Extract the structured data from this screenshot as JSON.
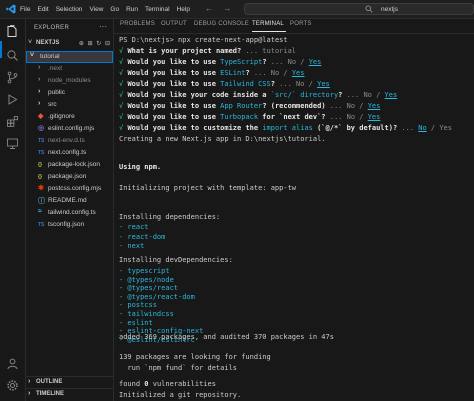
{
  "titlebar": {
    "menu": [
      "File",
      "Edit",
      "Selection",
      "View",
      "Go",
      "Run",
      "Terminal",
      "Help"
    ],
    "nav_arrows": "← →",
    "command_center": "nextjs"
  },
  "sidebar": {
    "title": "EXPLORER",
    "dots": "···",
    "project": "NEXTJS",
    "folder_chevron": "˅",
    "tools": "⊕ ⊞ ↻ ⊟",
    "tree": [
      {
        "label": "tutorial",
        "icon": "˅",
        "color": "#cccccc",
        "icon_color": "#cccccc"
      },
      {
        "label": ".next",
        "icon": "›",
        "color": "#8c8c8c",
        "icon_color": "#8c8c8c"
      },
      {
        "label": "node_modules",
        "icon": "›",
        "color": "#8c8c8c",
        "icon_color": "#8c8c8c"
      },
      {
        "label": "public",
        "icon": "›",
        "color": "#cccccc",
        "icon_color": "#cccccc"
      },
      {
        "label": "src",
        "icon": "›",
        "color": "#cccccc",
        "icon_color": "#cccccc"
      },
      {
        "label": ".gitignore",
        "icon": "◆",
        "color": "#cccccc",
        "icon_color": "#e35a3a"
      },
      {
        "label": "eslint.config.mjs",
        "icon": "◎",
        "color": "#cccccc",
        "icon_color": "#7b6fd8"
      },
      {
        "label": "next-env.d.ts",
        "icon": "TS",
        "color": "#8c8c8c",
        "icon_color": "#3178c6"
      },
      {
        "label": "next.config.ts",
        "icon": "TS",
        "color": "#cccccc",
        "icon_color": "#3178c6"
      },
      {
        "label": "package-lock.json",
        "icon": "{}",
        "color": "#cccccc",
        "icon_color": "#cbcb41"
      },
      {
        "label": "package.json",
        "icon": "{}",
        "color": "#cccccc",
        "icon_color": "#cbcb41"
      },
      {
        "label": "postcss.config.mjs",
        "icon": "✱",
        "color": "#cccccc",
        "icon_color": "#dd3a0a"
      },
      {
        "label": "README.md",
        "icon": "ⓘ",
        "color": "#cccccc",
        "icon_color": "#519aba"
      },
      {
        "label": "tailwind.config.ts",
        "icon": "≈",
        "color": "#cccccc",
        "icon_color": "#38bdf8"
      },
      {
        "label": "tsconfig.json",
        "icon": "TS",
        "color": "#cccccc",
        "icon_color": "#3178c6"
      }
    ],
    "outline": "OUTLINE",
    "timeline": "TIMELINE",
    "collapsed_chevron": "›"
  },
  "panel": {
    "tabs": [
      "PROBLEMS",
      "OUTPUT",
      "DEBUG CONSOLE",
      "TERMINAL",
      "PORTS"
    ],
    "active_tab": "TERMINAL"
  },
  "terminal": {
    "prompt": "PS D:\\nextjs> ",
    "command": "npx create-next-app@latest",
    "questions": [
      {
        "check": "√",
        "q": "What is your project named?",
        "a": " ... tutorial"
      },
      {
        "check": "√",
        "q": "Would you like to use ",
        "hl": "TypeScript",
        "q2": "?",
        "a": " ... No / ",
        "yes": "Yes"
      },
      {
        "check": "√",
        "q": "Would you like to use ",
        "hl": "ESLint",
        "q2": "?",
        "a": " ... No / ",
        "yes": "Yes"
      },
      {
        "check": "√",
        "q": "Would you like to use ",
        "hl": "Tailwind CSS",
        "q2": "?",
        "a": " ... No / ",
        "yes": "Yes"
      },
      {
        "check": "√",
        "q": "Would you like your code inside a ",
        "hl": "`src/` directory",
        "q2": "?",
        "a": " ... No / ",
        "yes": "Yes"
      },
      {
        "check": "√",
        "q": "Would you like to use ",
        "hl": "App Router",
        "q2": "? (recommended)",
        "a": " ... No / ",
        "yes": "Yes"
      },
      {
        "check": "√",
        "q": "Would you like to use ",
        "hl": "Turbopack",
        "q2": " for `next dev`?",
        "a": " ... No / ",
        "yes": "Yes"
      },
      {
        "check": "√",
        "q": "Would you like to customize the ",
        "hl": "import alias",
        "q2": " (`@/*` by default)?",
        "a": " ... ",
        "yes": "No",
        "a2": " / Yes"
      }
    ],
    "creating": "Creating a new Next.js app in D:\\nextjs\\tutorial.",
    "using": "Using npm.",
    "init": "Initializing project with template: app-tw",
    "deps_title": "Installing dependencies:",
    "deps": [
      "- react",
      "- react-dom",
      "- next"
    ],
    "devdeps_title": "Installing devDependencies:",
    "devdeps": [
      "- typescript",
      "- @types/node",
      "- @types/react",
      "- @types/react-dom",
      "- postcss",
      "- tailwindcss",
      "- eslint",
      "- eslint-config-next",
      "- @eslint/eslintrc"
    ],
    "added": "added 369 packages, and audited 370 packages in 47s",
    "funding1": "139 packages are looking for funding",
    "funding2": "  run `npm fund` for details",
    "found_prefix": "found ",
    "found_zero": "0",
    "found_suffix": " vulnerabilities",
    "git": "Initialized a git repository."
  }
}
